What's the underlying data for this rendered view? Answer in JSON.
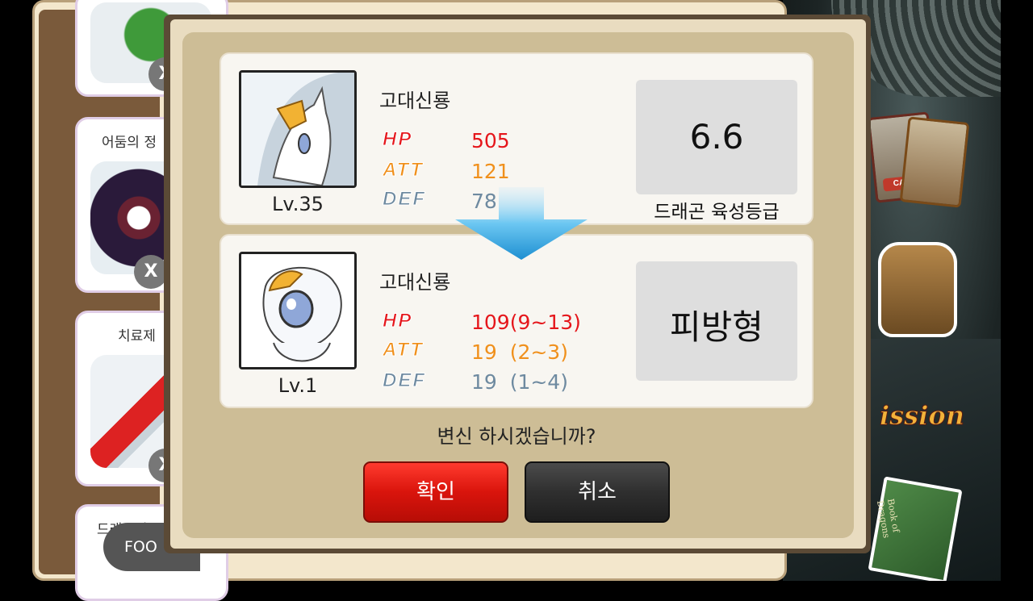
{
  "background": {
    "card_label": "CARD",
    "mission_label": "ission",
    "book_label": "Book of Dragons"
  },
  "shop": {
    "items": [
      {
        "label": ""
      },
      {
        "label": "어둠의 정",
        "badge": "X"
      },
      {
        "label": "치료제"
      },
      {
        "label": "드래곤의"
      }
    ],
    "food_tab": "FOO"
  },
  "modal": {
    "current": {
      "name": "고대신룡",
      "level": "Lv.35",
      "stats": [
        {
          "key": "HP",
          "value": "505"
        },
        {
          "key": "ATT",
          "value": "121"
        },
        {
          "key": "DEF",
          "value": "78"
        }
      ],
      "grade_value": "6.6",
      "grade_label": "드래곤 육성등급"
    },
    "new": {
      "name": "고대신룡",
      "level": "Lv.1",
      "stats": [
        {
          "key": "HP",
          "value": "109(9~13)"
        },
        {
          "key": "ATT",
          "value": "19  (2~3)"
        },
        {
          "key": "DEF",
          "value": "19  (1~4)"
        }
      ],
      "type_label": "피방형"
    },
    "question": "변신 하시겠습니까?",
    "confirm_label": "확인",
    "cancel_label": "취소"
  },
  "colors": {
    "hp": "#e5161b",
    "att": "#f0901c",
    "def": "#6e8aa0",
    "confirm": "#d9140c",
    "cancel": "#2f2f2f"
  }
}
